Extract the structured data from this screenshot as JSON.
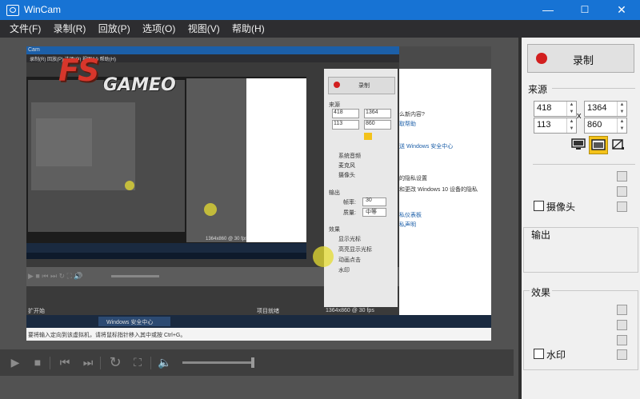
{
  "window": {
    "title": "WinCam",
    "minimize": "—",
    "maximize": "☐",
    "close": "✕"
  },
  "menu": [
    "文件(F)",
    "录制(R)",
    "回放(P)",
    "选项(O)",
    "视图(V)",
    "帮助(H)"
  ],
  "panel": {
    "record_label": "录制",
    "source": {
      "title": "来源",
      "x": "418",
      "width": "1364",
      "y": "113",
      "height": "860",
      "times": "x",
      "webcam_label": "摄像头"
    },
    "output": {
      "title": "输出"
    },
    "effects": {
      "title": "效果",
      "watermark_label": "水印"
    }
  },
  "preview": {
    "logo": "GAMEO",
    "logo_prefix": "FS",
    "window_title": "Cam",
    "menu_line": "录制(R)  回放(P)  选项(O)  视图(V)  帮助(H)",
    "record_label": "录制",
    "source_label": "来源",
    "x": "418",
    "width": "1364",
    "y": "113",
    "height": "860",
    "output_label": "输出",
    "fps_label": "帧率:",
    "fps_value": "30",
    "quality_label": "质量:",
    "quality_value": "中等",
    "chk_system_audio": "系统音频",
    "chk_mic": "麦克风",
    "chk_webcam": "摄像头",
    "effects_label": "效果",
    "chk_pointer": "显示光标",
    "chk_highlight": "高亮显示光标",
    "chk_clicks": "动画点击",
    "chk_watermark": "水印",
    "status_left": "扩开始",
    "status_mid": "项目就绪",
    "status_res": "1364x860 @ 30 fps",
    "taskbar_app": "Windows 安全中心",
    "prompt": "要将输入定向到该虚拟机，请将鼠标指针移入其中或按 Ctrl+G。",
    "side_text": [
      "么新内容?",
      "取帮助",
      "送 Windows 安全中心",
      "的隐私设置",
      "和更改 Windows 10 设备的隐私",
      "私仪表板",
      "私声明"
    ],
    "nested_status": "1364x860 @ 30 fps"
  }
}
